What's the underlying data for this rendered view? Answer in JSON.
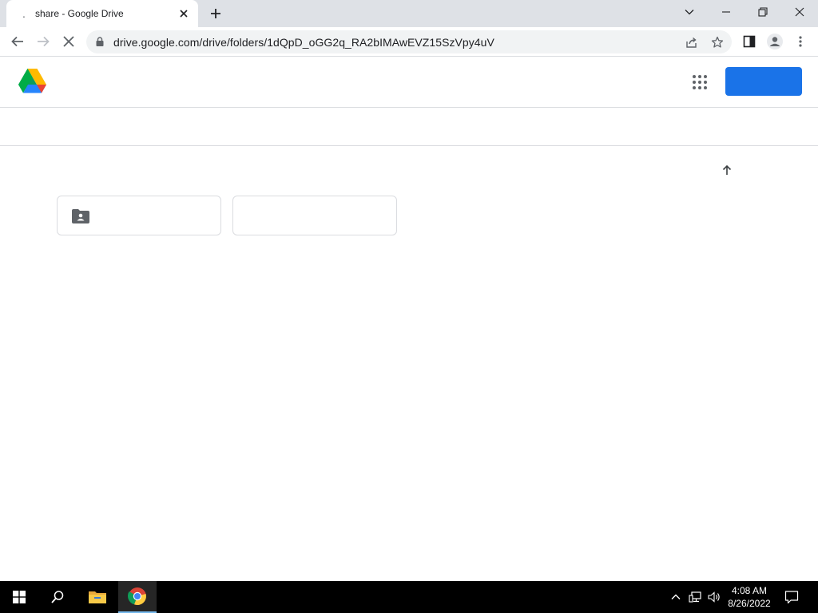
{
  "browser": {
    "tab": {
      "favicon": ".",
      "title": "share - Google Drive"
    },
    "address_bar": {
      "url": "drive.google.com/drive/folders/1dQpD_oGG2q_RA2bIMAwEVZ15SzVpy4uV"
    },
    "icons": [
      "chevron-down-icon",
      "minimize-icon",
      "restore-icon",
      "close-icon",
      "back-icon",
      "forward-icon",
      "stop-loading-icon",
      "lock-icon",
      "share-icon",
      "star-icon",
      "side-panel-icon",
      "profile-icon",
      "menu-icon"
    ]
  },
  "drive": {
    "header": {
      "icons": [
        "google-drive-logo",
        "apps-grid-icon"
      ],
      "signin_label": ""
    },
    "folders": [
      {
        "icon": "shared-folder-icon",
        "name": ""
      },
      {
        "icon": "",
        "name": ""
      }
    ]
  },
  "taskbar": {
    "icons": [
      "windows-start-icon",
      "search-icon",
      "file-explorer-icon",
      "chrome-icon"
    ],
    "tray_icons": [
      "chevron-up-icon",
      "network-icon",
      "volume-icon",
      "notifications-icon"
    ],
    "clock": {
      "time": "4:08 AM",
      "date": "8/26/2022"
    }
  },
  "colors": {
    "accent": "#1a73e8",
    "tabstrip": "#dee1e6",
    "omnibox": "#f1f3f4",
    "taskbar": "#000000"
  }
}
